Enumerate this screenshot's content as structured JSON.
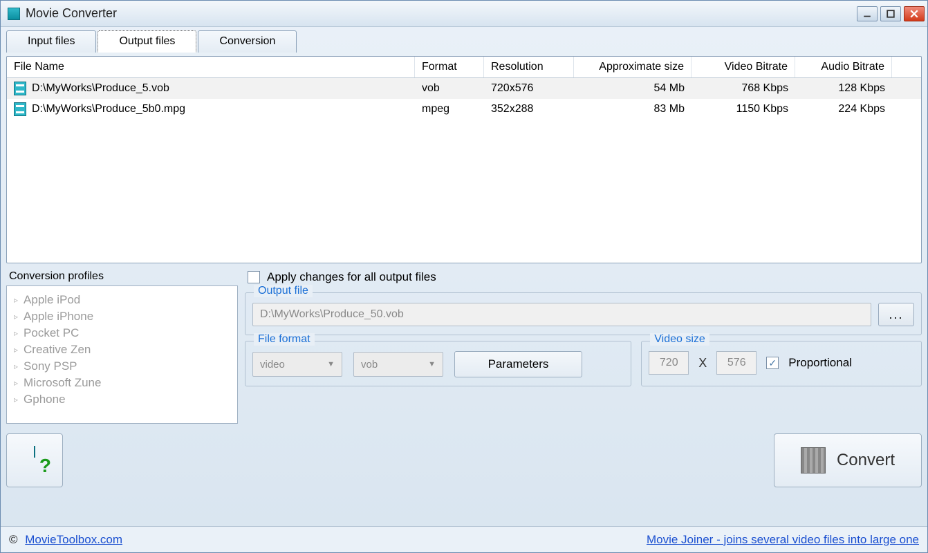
{
  "window": {
    "title": "Movie Converter"
  },
  "tabs": {
    "input": "Input files",
    "output": "Output files",
    "conversion": "Conversion"
  },
  "table": {
    "headers": {
      "name": "File Name",
      "format": "Format",
      "resolution": "Resolution",
      "approx_size": "Approximate size",
      "vbitrate": "Video Bitrate",
      "abitrate": "Audio Bitrate"
    },
    "rows": [
      {
        "name": "D:\\MyWorks\\Produce_5.vob",
        "format": "vob",
        "resolution": "720x576",
        "size": "54 Mb",
        "vbitrate": "768 Kbps",
        "abitrate": "128 Kbps"
      },
      {
        "name": "D:\\MyWorks\\Produce_5b0.mpg",
        "format": "mpeg",
        "resolution": "352x288",
        "size": "83 Mb",
        "vbitrate": "1150 Kbps",
        "abitrate": "224 Kbps"
      }
    ]
  },
  "profiles": {
    "title": "Conversion profiles",
    "items": [
      "Apple iPod",
      "Apple iPhone",
      "Pocket PC",
      "Creative Zen",
      "Sony PSP",
      "Microsoft Zune",
      "Gphone"
    ]
  },
  "apply_all": {
    "label": "Apply changes for all output files",
    "checked": false
  },
  "output_file": {
    "legend": "Output file",
    "path": "D:\\MyWorks\\Produce_50.vob",
    "browse": "..."
  },
  "file_format": {
    "legend": "File format",
    "type": "video",
    "container": "vob",
    "parameters_btn": "Parameters"
  },
  "video_size": {
    "legend": "Video size",
    "width": "720",
    "height": "576",
    "proportional_label": "Proportional",
    "proportional_checked": true,
    "separator": "X"
  },
  "convert_btn": "Convert",
  "footer": {
    "site": "MovieToolbox.com",
    "link": "Movie Joiner - joins several video files into large one"
  }
}
